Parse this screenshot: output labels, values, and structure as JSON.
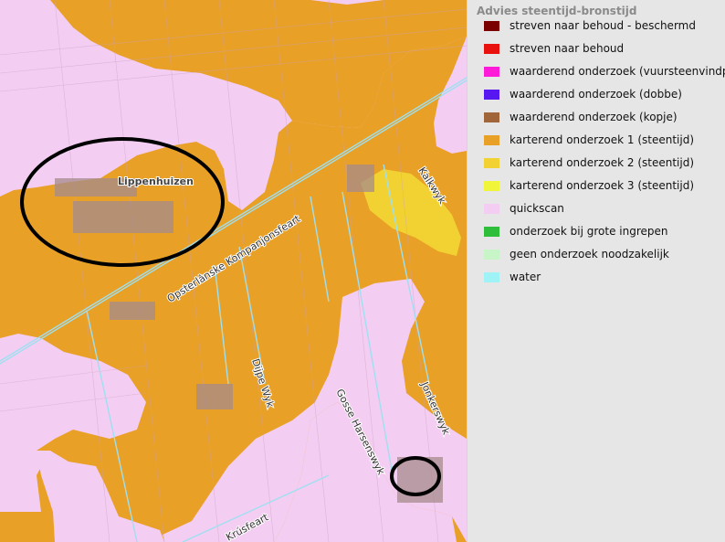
{
  "map": {
    "labels": {
      "lippenhuizen": "Lippenhuizen",
      "opsterlanske": "Opsterlânske Kompanjonsfeart",
      "kalkwyk": "Kalkwyk",
      "dijpe_wyk": "Dijpe Wyk",
      "gosse_harsenswyk": "Gosse Harsenswyk",
      "jonkerswyk": "Jonkerswyk",
      "krusfeart": "Krúsfeart"
    },
    "icons": [
      "circle-annotation"
    ],
    "colors": {
      "karterend1": "#e8a027",
      "karterend2": "#f2d232",
      "quickscan": "#f4cdf2",
      "water": "#9ee0f0",
      "annotation": "#000000"
    }
  },
  "legend": {
    "title": "Advies steentijd-bronstijd",
    "items": [
      {
        "label": "streven naar behoud - beschermd",
        "color": "#7a0000"
      },
      {
        "label": "streven naar behoud",
        "color": "#e8110d"
      },
      {
        "label": "waarderend onderzoek (vuursteenvindplaats)",
        "color": "#ff19d8"
      },
      {
        "label": "waarderend onderzoek (dobbe)",
        "color": "#5617f0"
      },
      {
        "label": "waarderend onderzoek (kopje)",
        "color": "#a0663a"
      },
      {
        "label": "karterend onderzoek 1 (steentijd)",
        "color": "#e8a027"
      },
      {
        "label": "karterend onderzoek 2 (steentijd)",
        "color": "#f2d232"
      },
      {
        "label": "karterend onderzoek 3 (steentijd)",
        "color": "#f0f53a"
      },
      {
        "label": "quickscan",
        "color": "#f4cdf2"
      },
      {
        "label": "onderzoek bij grote ingrepen",
        "color": "#2fbe3a"
      },
      {
        "label": "geen onderzoek noodzakelijk",
        "color": "#c8f5c8"
      },
      {
        "label": "water",
        "color": "#9ff2f5"
      }
    ]
  }
}
